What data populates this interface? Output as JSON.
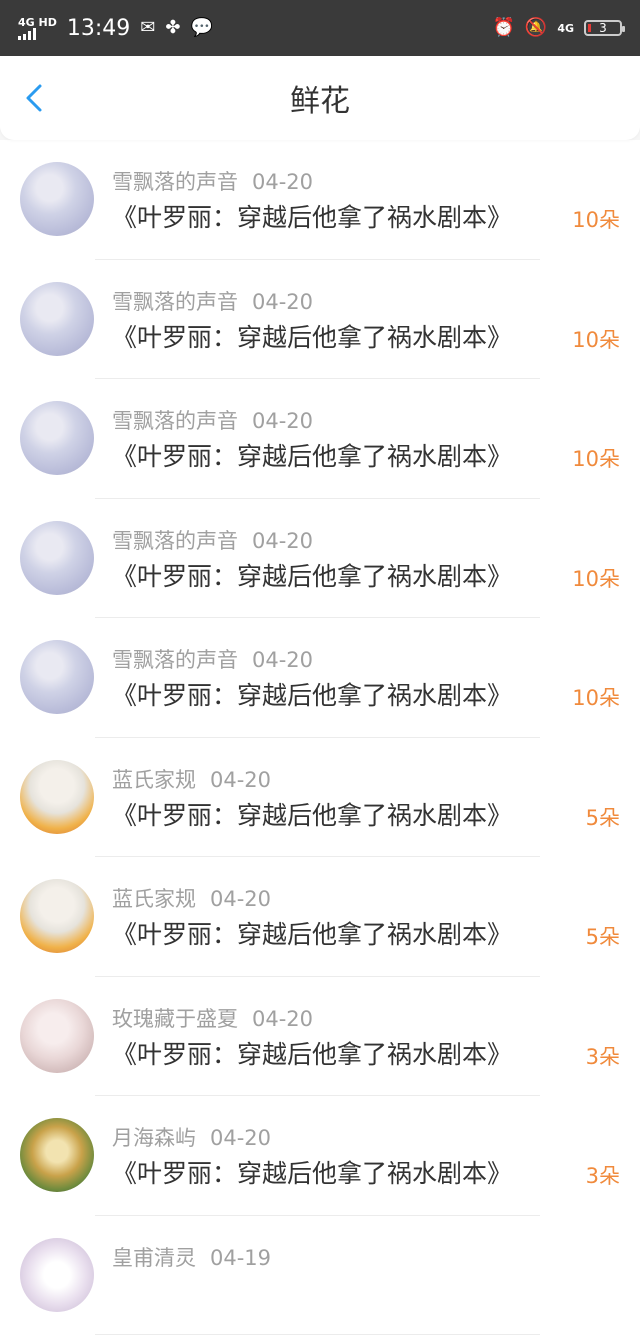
{
  "status_bar": {
    "network": "4G HD",
    "time": "13:49",
    "net_right": "4G",
    "battery": "3"
  },
  "header": {
    "title": "鲜花"
  },
  "items": [
    {
      "user": "雪飘落的声音",
      "date": "04-20",
      "book": "《叶罗丽：穿越后他拿了祸水剧本》",
      "amount": "10朵"
    },
    {
      "user": "雪飘落的声音",
      "date": "04-20",
      "book": "《叶罗丽：穿越后他拿了祸水剧本》",
      "amount": "10朵"
    },
    {
      "user": "雪飘落的声音",
      "date": "04-20",
      "book": "《叶罗丽：穿越后他拿了祸水剧本》",
      "amount": "10朵"
    },
    {
      "user": "雪飘落的声音",
      "date": "04-20",
      "book": "《叶罗丽：穿越后他拿了祸水剧本》",
      "amount": "10朵"
    },
    {
      "user": "雪飘落的声音",
      "date": "04-20",
      "book": "《叶罗丽：穿越后他拿了祸水剧本》",
      "amount": "10朵"
    },
    {
      "user": "蓝氏家规",
      "date": "04-20",
      "book": "《叶罗丽：穿越后他拿了祸水剧本》",
      "amount": "5朵"
    },
    {
      "user": "蓝氏家规",
      "date": "04-20",
      "book": "《叶罗丽：穿越后他拿了祸水剧本》",
      "amount": "5朵"
    },
    {
      "user": "玫瑰藏于盛夏",
      "date": "04-20",
      "book": "《叶罗丽：穿越后他拿了祸水剧本》",
      "amount": "3朵"
    },
    {
      "user": "月海森屿",
      "date": "04-20",
      "book": "《叶罗丽：穿越后他拿了祸水剧本》",
      "amount": "3朵"
    },
    {
      "user": "皇甫清灵",
      "date": "04-19",
      "book": "",
      "amount": ""
    }
  ],
  "colors": {
    "accent": "#2a9bf0",
    "amount": "#f08a3c",
    "status_bar": "#3a3a3a"
  }
}
